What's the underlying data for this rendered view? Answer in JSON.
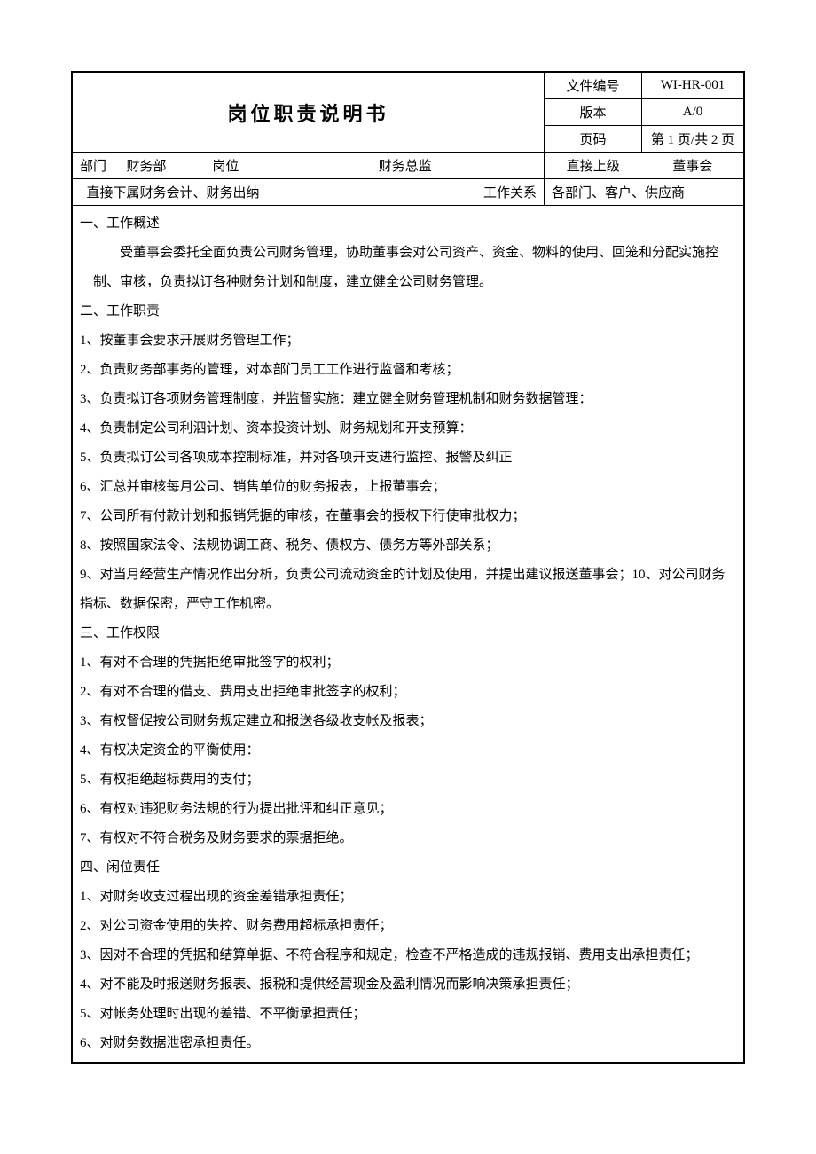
{
  "header": {
    "title": "岗位职责说明书",
    "meta": {
      "doc_no_label": "文件编号",
      "doc_no_value": "WI-HR-001",
      "version_label": "版本",
      "version_value": "A/0",
      "page_label": "页码",
      "page_value": "第 1 页/共 2 页"
    }
  },
  "info": {
    "dept_label": "部门",
    "dept_value": "财务部",
    "position_label": "岗位",
    "position_value": "财务总监",
    "supervisor_label": "直接上级",
    "supervisor_value": "董事会",
    "subordinate_row": "直接下属财务会计、财务出纳",
    "relation_label": "工作关系",
    "relation_value": "各部门、客户、供应商"
  },
  "sections": {
    "s1_title": "一、工作概述",
    "s1_body": "受董事会委托全面负责公司财务管理，协助董事会对公司资产、资金、物料的使用、回笼和分配实施控制、审核，负责拟订各种财务计划和制度，建立健全公司财务管理。",
    "s2_title": "二、工作职责",
    "s2_items": [
      "1、按董事会要求开展财务管理工作；",
      "2、负责财务部事务的管理，对本部门员工工作进行监督和考核；",
      "3、负责拟订各项财务管理制度，并监督实施：建立健全财务管理机制和财务数据管理：",
      "4、负责制定公司利泗计划、资本投资计划、财务规划和开支预算：",
      "5、负责拟订公司各项成本控制标准，并对各项开支进行监控、报警及纠正",
      "6、汇总并审核每月公司、销售单位的财务报表，上报董事会；",
      "7、公司所有付款计划和报销凭据的审核，在董事会的授权下行使审批权力；",
      "8、按照国家法令、法规协调工商、税务、债权方、债务方等外部关系；",
      "9、对当月经营生产情况作出分析，负责公司流动资金的计划及使用，并提出建议报送董事会；10、对公司财务指标、数据保密，严守工作机密。"
    ],
    "s3_title": "三、工作权限",
    "s3_items": [
      "1、有对不合理的凭据拒绝审批签字的权利；",
      "2、有对不合理的借支、费用支出拒绝审批签字的权利；",
      "3、有权督促按公司财务规定建立和报送各级收支帐及报表；",
      "4、有权决定资金的平衡使用：",
      "5、有权拒绝超标费用的支付；",
      "6、有权对违犯财务法規的行为提出批评和纠正意见；",
      "7、有权对不符合税务及财务要求的票据拒绝。"
    ],
    "s4_title": "四、闲位责任",
    "s4_items": [
      "1、对财务收支过程出现的资金差错承担责任；",
      "2、对公司资金使用的失控、财务费用超标承担责任；",
      "3、因对不合理的凭据和结算单据、不符合程序和规定，检查不严格造成的违规报销、费用支出承担责任；",
      "4、对不能及时报送财务报表、报税和提供经营现金及盈利情况而影响决策承担责任；",
      "5、对帐务处理时出现的差错、不平衡承担责任；",
      "6、对财务数据泄密承担责任。"
    ]
  }
}
